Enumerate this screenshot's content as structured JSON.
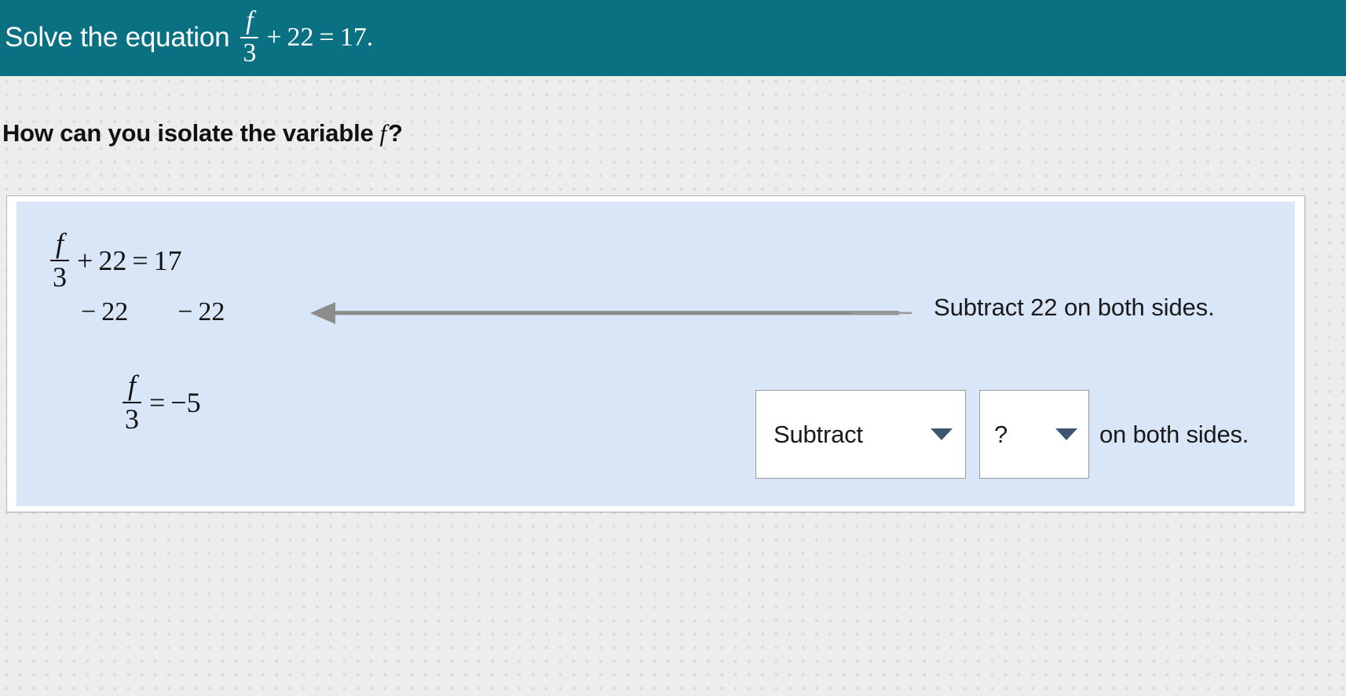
{
  "header": {
    "prompt_prefix": "Solve the equation",
    "equation": {
      "numerator": "f",
      "denominator": "3",
      "plus": "+",
      "addend": "22",
      "equals": "=",
      "result": "17",
      "period": "."
    },
    "background_color": "#0a7183",
    "text_color": "#ffffff"
  },
  "question": {
    "text_before": "How can you isolate the variable",
    "variable": "f",
    "text_after": "?"
  },
  "work": {
    "panel_color": "#d9e6f8",
    "card_color": "#ffffff",
    "line1": {
      "numerator": "f",
      "denominator": "3",
      "plus": "+",
      "addend": "22",
      "equals": "=",
      "result": "17"
    },
    "line2": {
      "left_minus": "−",
      "left_value": "22",
      "right_minus": "−",
      "right_value": "22"
    },
    "line3": {
      "numerator": "f",
      "denominator": "3",
      "equals": "=",
      "result": "−5"
    },
    "annotation_completed": "Subtract 22 on both sides.",
    "arrow": {
      "name": "left-arrow",
      "color": "#8c8c8c",
      "direction": "left"
    }
  },
  "interactive_row": {
    "operation_dropdown": {
      "value": "Subtract",
      "caret": "▼"
    },
    "value_dropdown": {
      "value": "?",
      "caret": "▼"
    },
    "suffix_text": "on both sides.",
    "caret_color": "#3d556e",
    "border_color": "#9a9a9a"
  }
}
